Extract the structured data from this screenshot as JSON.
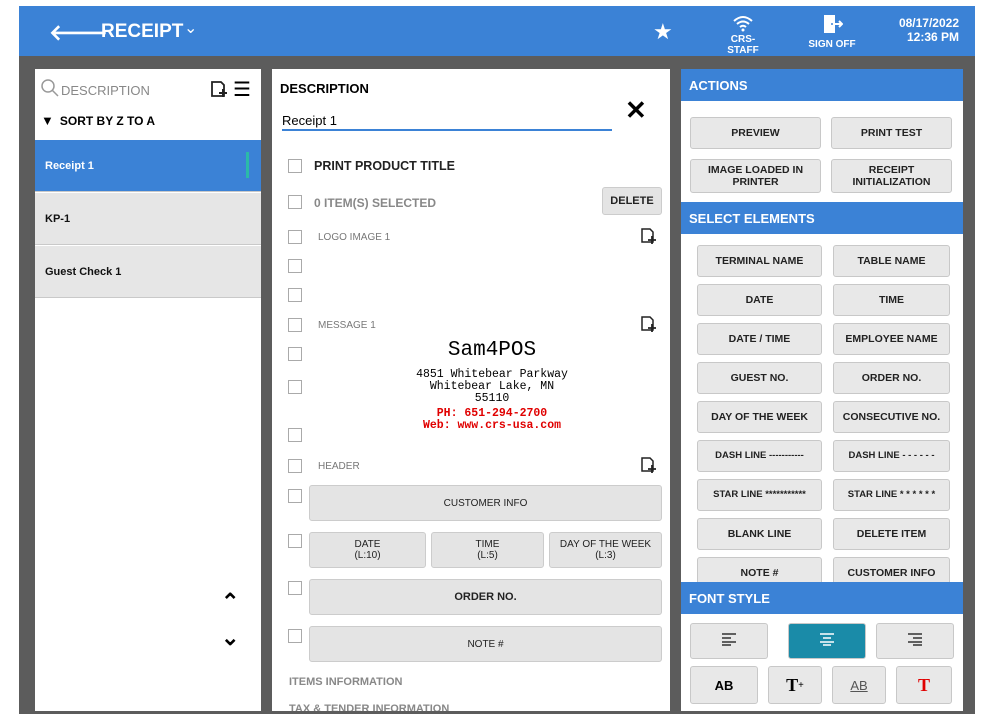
{
  "topbar": {
    "title": "RECEIPT",
    "wifi_label": "CRS-STAFF",
    "signoff_label": "SIGN OFF",
    "date": "08/17/2022",
    "time": "12:36 PM"
  },
  "left": {
    "search_placeholder": "DESCRIPTION",
    "sort_label": "SORT BY Z TO A",
    "items": [
      {
        "label": "Receipt 1"
      },
      {
        "label": "KP-1"
      },
      {
        "label": "Guest Check 1"
      }
    ]
  },
  "mid": {
    "desc_title": "DESCRIPTION",
    "desc_value": "Receipt 1",
    "print_product_title": "PRINT PRODUCT TITLE",
    "items_selected": "0 ITEM(S) SELECTED",
    "delete_label": "DELETE",
    "logo_image": "LOGO IMAGE 1",
    "message": "MESSAGE 1",
    "header": "HEADER",
    "receipt": {
      "name": "Sam4POS",
      "addr1": "4851 Whitebear Parkway",
      "addr2": "Whitebear Lake, MN",
      "zip": "55110",
      "phone": "PH: 651-294-2700",
      "web": "Web: www.crs-usa.com"
    },
    "customer_info": "CUSTOMER INFO",
    "date_btn": "DATE",
    "date_len": "(L:10)",
    "time_btn": "TIME",
    "time_len": "(L:5)",
    "dow_btn": "DAY OF THE WEEK",
    "dow_len": "(L:3)",
    "order_no": "ORDER NO.",
    "note": "NOTE #",
    "items_info": "ITEMS INFORMATION",
    "tax_info": "TAX & TENDER INFORMATION"
  },
  "right": {
    "actions_title": "ACTIONS",
    "preview": "PREVIEW",
    "print_test": "PRINT TEST",
    "image_loaded_1": "IMAGE LOADED IN",
    "image_loaded_2": "PRINTER",
    "receipt_init_1": "RECEIPT",
    "receipt_init_2": "INITIALIZATION",
    "select_title": "SELECT ELEMENTS",
    "elements": [
      "TERMINAL NAME",
      "TABLE NAME",
      "DATE",
      "TIME",
      "DATE / TIME",
      "EMPLOYEE NAME",
      "GUEST NO.",
      "ORDER NO.",
      "DAY OF THE WEEK",
      "CONSECUTIVE NO.",
      "DASH LINE -----------",
      "DASH LINE - - - - - -",
      "STAR LINE ***********",
      "STAR LINE * * * * * *",
      "BLANK LINE",
      "DELETE ITEM",
      "NOTE #",
      "CUSTOMER INFO"
    ],
    "font_title": "FONT STYLE",
    "style_ab": "AB",
    "style_ab_under": "AB",
    "style_t": "T",
    "style_t_red": "T"
  },
  "colors": {
    "accent": "#3b82d6",
    "active": "#1a8ba8",
    "receipt_red": "#e00000"
  }
}
